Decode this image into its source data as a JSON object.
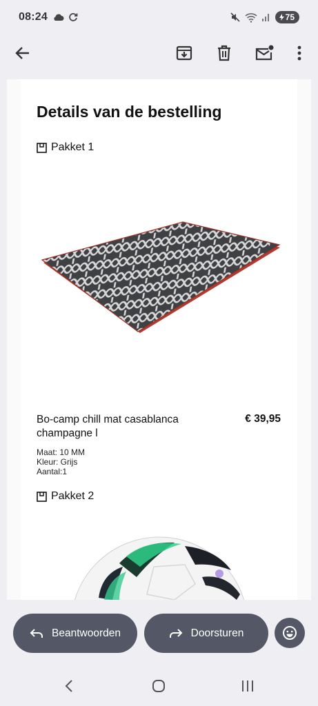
{
  "status_bar": {
    "time": "08:24",
    "battery": "75",
    "icons": [
      "cloud-icon",
      "sync-icon",
      "mute-icon",
      "wifi-icon",
      "signal-icon",
      "battery-icon"
    ]
  },
  "app_bar": {
    "back_icon": "arrow-back-icon",
    "actions": [
      "archive-icon",
      "delete-icon",
      "mark-unread-icon",
      "more-vert-icon"
    ]
  },
  "email": {
    "title": "Details van de bestelling",
    "packages": [
      {
        "label": "Pakket 1",
        "product": {
          "name": "Bo-camp chill mat casablanca champagne l",
          "price": "€ 39,95",
          "size": "Maat: 10 MM",
          "color": "Kleur: Grijs",
          "quantity": "Aantal:1"
        }
      },
      {
        "label": "Pakket 2"
      }
    ]
  },
  "actions": {
    "reply_label": "Beantwoorden",
    "forward_label": "Doorsturen",
    "emoji_icon": "emoji-reaction-icon"
  },
  "nav": {
    "buttons": [
      "nav-back-icon",
      "nav-home-icon",
      "nav-recents-icon"
    ]
  },
  "colors": {
    "background": "#eeeef3",
    "button": "#545866",
    "card": "#ffffff",
    "mat_accent": "#c0392b"
  }
}
